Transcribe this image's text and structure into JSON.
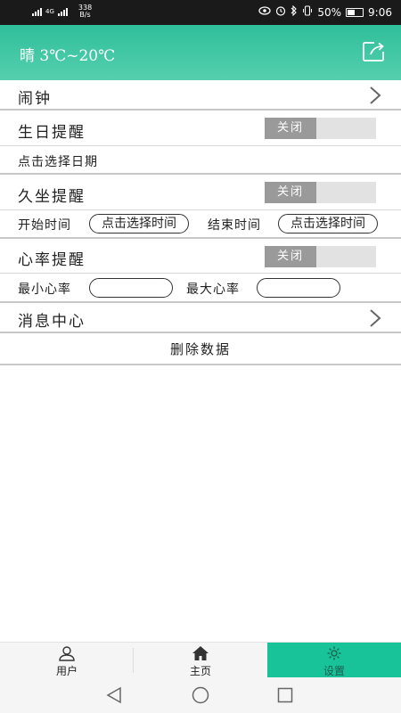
{
  "status_bar": {
    "net_speed_value": "338",
    "net_speed_unit": "B/s",
    "sim_label": "4G",
    "battery": "50%",
    "time": "9:06"
  },
  "header": {
    "weather": "晴  3℃~20℃"
  },
  "alarm": {
    "title": "闹钟"
  },
  "birthday": {
    "title": "生日提醒",
    "toggle_label": "关闭",
    "date_prompt": "点击选择日期"
  },
  "sedentary": {
    "title": "久坐提醒",
    "toggle_label": "关闭",
    "start_label": "开始时间",
    "start_value": "点击选择时间",
    "end_label": "结束时间",
    "end_value": "点击选择时间"
  },
  "heart_rate": {
    "title": "心率提醒",
    "toggle_label": "关闭",
    "min_label": "最小心率",
    "min_value": "",
    "max_label": "最大心率",
    "max_value": ""
  },
  "messages": {
    "title": "消息中心"
  },
  "delete_label": "删除数据",
  "tabs": [
    {
      "label": "用户",
      "icon": "user-icon"
    },
    {
      "label": "主页",
      "icon": "home-icon"
    },
    {
      "label": "设置",
      "icon": "gear-icon"
    }
  ],
  "colors": {
    "accent": "#18c39a",
    "header": "#2fbf9a",
    "toggle_off": "#9a9a9a"
  }
}
